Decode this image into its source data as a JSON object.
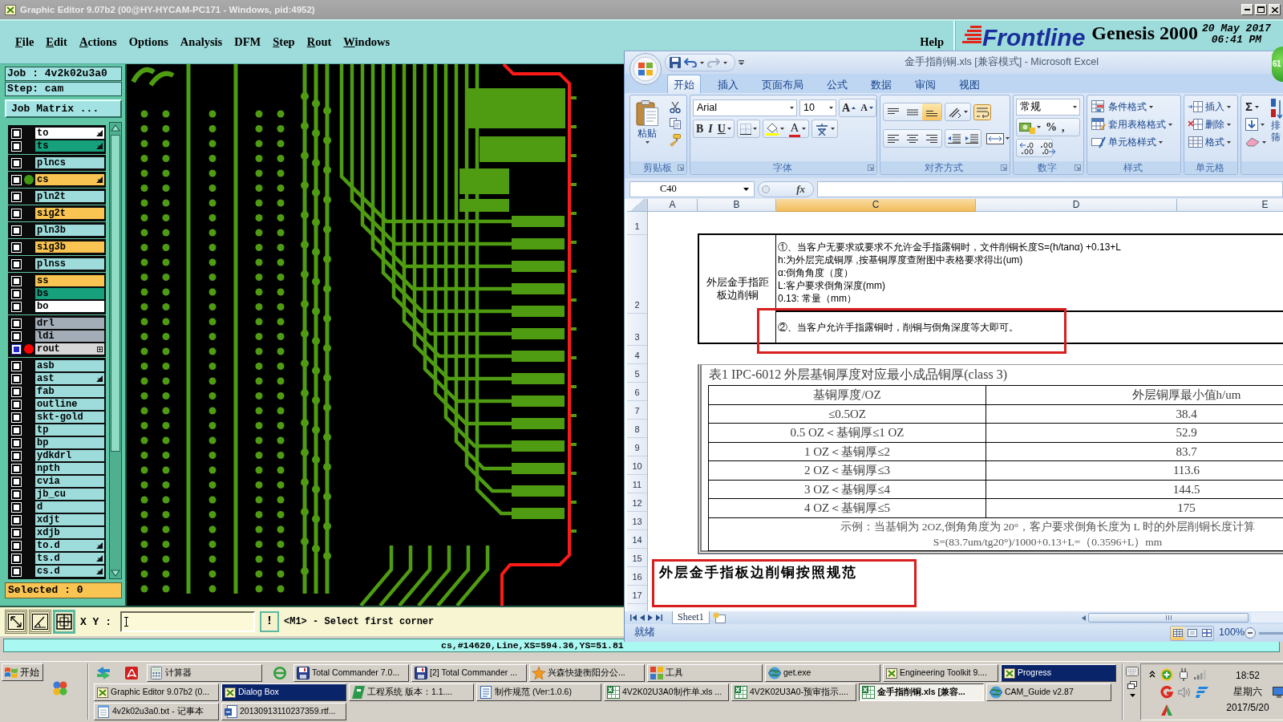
{
  "genesis": {
    "title": "Graphic Editor 9.07b2 (00@HY-HYCAM-PC171 - Windows, pid:4952)",
    "menu": [
      {
        "label": "File",
        "mnemonic": true
      },
      {
        "label": "Edit",
        "mnemonic": true
      },
      {
        "label": "Actions",
        "mnemonic": true
      },
      {
        "label": "Options",
        "mnemonic": false
      },
      {
        "label": "Analysis",
        "mnemonic": false
      },
      {
        "label": "DFM",
        "mnemonic": false
      },
      {
        "label": "Step",
        "mnemonic": true
      },
      {
        "label": "Rout",
        "mnemonic": true
      },
      {
        "label": "Windows",
        "mnemonic": true
      }
    ],
    "help": "Help",
    "brand": "Frontline",
    "product": "Genesis 2000",
    "date": "20 May 2017",
    "time": "06:41 PM",
    "job": "Job : 4v2k02u3a0",
    "step": "Step: cam",
    "job_matrix": "Job Matrix ...",
    "layer_groups": [
      {
        "layers": [
          {
            "name": "to",
            "color": "#ffffff",
            "pointer": true,
            "expandable": false,
            "affected": false
          },
          {
            "name": "ts",
            "color": "#17a07c",
            "pointer": true,
            "expandable": false,
            "affected": false
          }
        ]
      },
      {
        "layers": [
          {
            "name": "plncs",
            "color": "#9edcdc",
            "pointer": false,
            "expandable": false,
            "affected": false
          }
        ]
      },
      {
        "layers": [
          {
            "name": "cs",
            "color": "#f9c451",
            "pointer": true,
            "expandable": false,
            "affected": false,
            "display": {
              "color": "#3f9a12"
            }
          }
        ]
      },
      {
        "layers": [
          {
            "name": "pln2t",
            "color": "#9edcdc",
            "pointer": false,
            "expandable": false,
            "affected": false
          }
        ]
      },
      {
        "layers": [
          {
            "name": "sig2t",
            "color": "#f9c451",
            "pointer": false,
            "expandable": false,
            "affected": false
          }
        ]
      },
      {
        "layers": [
          {
            "name": "pln3b",
            "color": "#9edcdc",
            "pointer": false,
            "expandable": false,
            "affected": false
          }
        ]
      },
      {
        "layers": [
          {
            "name": "sig3b",
            "color": "#f9c451",
            "pointer": false,
            "expandable": false,
            "affected": false
          }
        ]
      },
      {
        "layers": [
          {
            "name": "plnss",
            "color": "#9edcdc",
            "pointer": false,
            "expandable": false,
            "affected": false
          }
        ]
      },
      {
        "layers": [
          {
            "name": "ss",
            "color": "#f9c451",
            "pointer": false,
            "expandable": false,
            "affected": false
          },
          {
            "name": "bs",
            "color": "#17a07c",
            "pointer": false,
            "expandable": false,
            "affected": false
          },
          {
            "name": "bo",
            "color": "#ffffff",
            "pointer": false,
            "expandable": false,
            "affected": false
          }
        ]
      },
      {
        "layers": [
          {
            "name": "drl",
            "color": "#a3adb7",
            "pointer": false,
            "expandable": false,
            "affected": false
          },
          {
            "name": "ldi",
            "color": "#a3adb7",
            "pointer": false,
            "expandable": false,
            "affected": false
          },
          {
            "name": "rout",
            "color": "#d7d7d7",
            "pointer": false,
            "expandable": true,
            "affected": true,
            "display": {
              "color": "#ff0000"
            }
          }
        ]
      },
      {
        "layers": [
          {
            "name": "asb",
            "color": "#9edcdc",
            "pointer": false,
            "expandable": false,
            "affected": false
          },
          {
            "name": "ast",
            "color": "#9edcdc",
            "pointer": true,
            "expandable": false,
            "affected": false
          },
          {
            "name": "fab",
            "color": "#9edcdc",
            "pointer": false,
            "expandable": false,
            "affected": false
          },
          {
            "name": "outline",
            "color": "#9edcdc",
            "pointer": false,
            "expandable": false,
            "affected": false
          },
          {
            "name": "skt-gold",
            "color": "#9edcdc",
            "pointer": false,
            "expandable": false,
            "affected": false
          },
          {
            "name": "tp",
            "color": "#9edcdc",
            "pointer": false,
            "expandable": false,
            "affected": false
          },
          {
            "name": "bp",
            "color": "#9edcdc",
            "pointer": false,
            "expandable": false,
            "affected": false
          },
          {
            "name": "ydkdrl",
            "color": "#9edcdc",
            "pointer": false,
            "expandable": false,
            "affected": false
          },
          {
            "name": "npth",
            "color": "#9edcdc",
            "pointer": false,
            "expandable": false,
            "affected": false
          },
          {
            "name": "cvia",
            "color": "#9edcdc",
            "pointer": false,
            "expandable": false,
            "affected": false
          },
          {
            "name": "jb_cu",
            "color": "#9edcdc",
            "pointer": false,
            "expandable": false,
            "affected": false
          },
          {
            "name": "d",
            "color": "#9edcdc",
            "pointer": false,
            "expandable": false,
            "affected": false
          },
          {
            "name": "xdjt",
            "color": "#9edcdc",
            "pointer": false,
            "expandable": false,
            "affected": false
          },
          {
            "name": "xdjb",
            "color": "#9edcdc",
            "pointer": false,
            "expandable": false,
            "affected": false
          },
          {
            "name": "to.d",
            "color": "#9edcdc",
            "pointer": true,
            "expandable": false,
            "affected": false
          },
          {
            "name": "ts.d",
            "color": "#9edcdc",
            "pointer": true,
            "expandable": false,
            "affected": false
          },
          {
            "name": "cs.d",
            "color": "#9edcdc",
            "pointer": true,
            "expandable": false,
            "affected": false
          }
        ]
      }
    ],
    "selected_count": "Selected : 0",
    "tool_buttons": [
      {
        "on": false
      },
      {
        "on": false
      },
      {
        "on": true
      }
    ],
    "xy_label": "X Y :",
    "alert_button": "!",
    "prompt": "<M1> - Select first corner",
    "status": "cs,#14620,Line,XS=594.36,YS=51.81"
  },
  "excel": {
    "title": "金手指削铜.xls  [兼容模式] - Microsoft Excel",
    "tabs": [
      {
        "label": "开始",
        "selected": true
      },
      {
        "label": "插入",
        "selected": false
      },
      {
        "label": "页面布局",
        "selected": false
      },
      {
        "label": "公式",
        "selected": false
      },
      {
        "label": "数据",
        "selected": false
      },
      {
        "label": "审阅",
        "selected": false
      },
      {
        "label": "视图",
        "selected": false
      }
    ],
    "clipboard": {
      "paste": "粘贴",
      "group": "剪贴板"
    },
    "font": {
      "name": "Arial",
      "size": "10",
      "grow": "A",
      "shrink": "A",
      "styles": [
        "B",
        "I",
        "U"
      ],
      "color_letter": "A",
      "group": "字体"
    },
    "alignment": {
      "vertical": [
        {
          "selected": false
        },
        {
          "selected": false
        },
        {
          "selected": true
        }
      ],
      "group": "对齐方式"
    },
    "number": {
      "format": "常规",
      "percent": "%",
      "comma": ",",
      "group": "数字"
    },
    "styles": {
      "items": [
        "条件格式",
        "套用表格格式",
        "单元格样式"
      ],
      "group": "样式"
    },
    "cells": {
      "items": [
        "插入",
        "删除",
        "格式"
      ],
      "group": "单元格"
    },
    "editing": {
      "sum": "Σ",
      "labels": [
        "排",
        "筛"
      ]
    },
    "name_box": "C40",
    "function_button": "fx",
    "columns": [
      {
        "label": "A",
        "selected": false
      },
      {
        "label": "B",
        "selected": false
      },
      {
        "label": "C",
        "selected": true
      },
      {
        "label": "D",
        "selected": false
      },
      {
        "label": "E",
        "selected": false
      }
    ],
    "rows": [
      "1",
      "2",
      "3",
      "4",
      "5",
      "6",
      "7",
      "8",
      "9",
      "10",
      "11",
      "12",
      "13",
      "14",
      "15",
      "16",
      "17"
    ],
    "note": {
      "heading": "外层金手指距板边削铜",
      "lines": [
        "①、当客户无要求或要求不允许金手指露铜时，文件削铜长度S=(h/tanα) +0.13+L",
        "h:为外层完成铜厚 ,按基铜厚度查附图中表格要求得出(um)",
        "α:倒角角度（度）",
        "L:客户要求倒角深度(mm)",
        "0.13: 常量（mm）"
      ],
      "rule": "②、当客户允许手指露铜时，削铜与倒角深度等大即可。"
    },
    "table": {
      "caption": "表1 IPC-6012 外层基铜厚度对应最小成品铜厚(class 3)",
      "header": [
        "基铜厚度/OZ",
        "外层铜厚最小值h/um"
      ],
      "rows": [
        [
          "≤0.5OZ",
          "38.4"
        ],
        [
          "0.5 OZ＜基铜厚≤1 OZ",
          "52.9"
        ],
        [
          "1 OZ＜基铜厚≤2",
          "83.7"
        ],
        [
          "2 OZ＜基铜厚≤3",
          "113.6"
        ],
        [
          "3 OZ＜基铜厚≤4",
          "144.5"
        ],
        [
          "4 OZ＜基铜厚≤5",
          "175"
        ]
      ],
      "example": [
        "示例：当基铜为 2OZ,倒角角度为 20°，客户要求倒角长度为 L 时的外层削铜长度计算",
        "S=(83.7um/tg20°)/1000+0.13+L=（0.3596+L）mm"
      ]
    },
    "callout": "外层金手指板边削铜按照规范",
    "sheet_tab": "Sheet1",
    "status": "就绪",
    "view_buttons": [
      {
        "selected": true
      },
      {
        "selected": false
      },
      {
        "selected": false
      }
    ],
    "zoom": "100%"
  },
  "float_badge": "61",
  "taskbar": {
    "start": "开始",
    "rows": [
      [
        {
          "label": "计算器",
          "selected": false,
          "flashing": false
        },
        {
          "label": "Total Commander 7.0...",
          "selected": false,
          "flashing": false
        },
        {
          "label": "[2] Total Commander ...",
          "selected": false,
          "flashing": false
        },
        {
          "label": "兴森快捷衡阳分公...",
          "selected": false,
          "flashing": false
        },
        {
          "label": "工具",
          "selected": false,
          "flashing": false
        },
        {
          "label": "get.exe",
          "selected": false,
          "flashing": false
        },
        {
          "label": "Engineering Toolkit 9....",
          "selected": false,
          "flashing": false
        },
        {
          "label": "Progress",
          "selected": false,
          "flashing": true
        }
      ],
      [
        {
          "label": "Graphic Editor 9.07b2 (0...",
          "selected": false,
          "flashing": false
        },
        {
          "label": "Dialog Box",
          "selected": false,
          "flashing": true
        },
        {
          "label": "工程系统  版本：1.1....",
          "selected": false,
          "flashing": false
        },
        {
          "label": "制作规范 (Ver:1.0.6)",
          "selected": false,
          "flashing": false
        },
        {
          "label": "4V2K02U3A0制作单.xls ...",
          "selected": false,
          "flashing": false
        },
        {
          "label": "4V2K02U3A0-预审指示....",
          "selected": false,
          "flashing": false
        },
        {
          "label": "金手指削铜.xls [兼容...",
          "selected": true,
          "flashing": false
        },
        {
          "label": "CAM_Guide v2.87",
          "selected": false,
          "flashing": false
        }
      ],
      [
        {
          "label": "4v2k02u3a0.txt - 记事本",
          "selected": false,
          "flashing": false
        },
        {
          "label": "20130913110237359.rtf...",
          "selected": false,
          "flashing": false
        }
      ]
    ],
    "clock": {
      "time": "18:52",
      "weekday": "星期六",
      "date": "2017/5/20"
    }
  }
}
